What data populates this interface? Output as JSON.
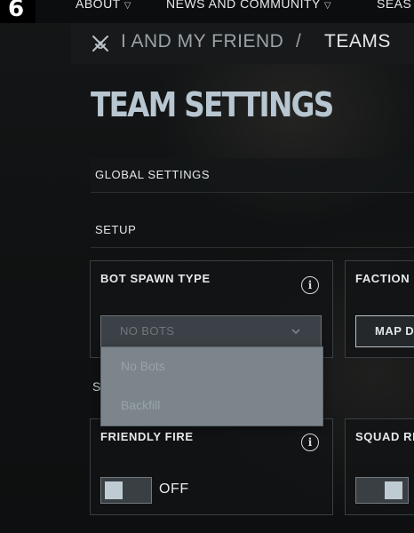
{
  "nav": {
    "logo_glyph": "6",
    "items": [
      {
        "label": "ABOUT",
        "chevron": "▽"
      },
      {
        "label": "NEWS AND COMMUNITY",
        "chevron": "▽"
      },
      {
        "label": "SEAS"
      }
    ]
  },
  "breadcrumb": {
    "icon": "crossed-swords-icon",
    "parent": "I AND MY FRIEND",
    "separator": "/",
    "current": "TEAMS"
  },
  "page": {
    "title": "TEAM SETTINGS"
  },
  "sections": {
    "global": "GLOBAL SETTINGS",
    "setup": "SETUP",
    "partial_letter": "S"
  },
  "bot_spawn": {
    "title": "BOT SPAWN TYPE",
    "selected": "NO BOTS",
    "options": [
      "No Bots",
      "Backfill"
    ],
    "open": true
  },
  "faction": {
    "title": "FACTION",
    "button_label": "MAP D"
  },
  "friendly_fire": {
    "title": "FRIENDLY FIRE",
    "state": "OFF",
    "on": false
  },
  "squad": {
    "title": "SQUAD RI",
    "on": true
  },
  "info_glyph": "i",
  "colors": {
    "title": "#b7c6d0",
    "muted": "#9aa2a8",
    "dropdown_bg": "#7b858b"
  }
}
